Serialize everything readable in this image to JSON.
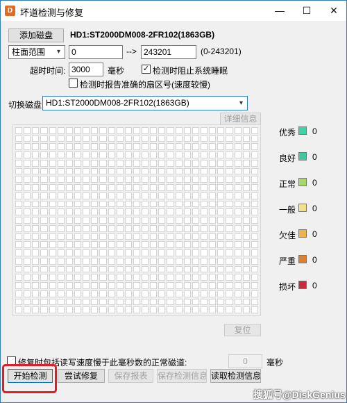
{
  "window": {
    "title": "坏道检测与修复",
    "icon_label": "D",
    "controls": {
      "minimize": "—",
      "maximize": "☐",
      "close": "✕"
    }
  },
  "toolbar": {
    "add_disk_label": "添加磁盘",
    "disk_name": "HD1:ST2000DM008-2FR102(1863GB)"
  },
  "range": {
    "mode_options_selected": "柱面范围",
    "from_value": "0",
    "arrow": "-->",
    "to_value": "243201",
    "hint": "(0-243201)"
  },
  "timeout": {
    "label": "超时时间:",
    "value": "3000",
    "unit": "毫秒",
    "prevent_sleep_label": "检测时阻止系统睡眠",
    "prevent_sleep_checked": "✓",
    "report_sectors_label": "检测时报告准确的扇区号(速度较慢)",
    "report_sectors_checked": ""
  },
  "switch_disk": {
    "label": "切换磁盘:",
    "selected": "HD1:ST2000DM008-2FR102(1863GB)"
  },
  "detail_button_label": "详细信息",
  "reset_button_label": "复位",
  "legend": [
    {
      "label": "优秀",
      "count": "0",
      "color": "#3fd4a8"
    },
    {
      "label": "良好",
      "count": "0",
      "color": "#3ec9a0"
    },
    {
      "label": "正常",
      "count": "0",
      "color": "#a8d86a"
    },
    {
      "label": "一般",
      "count": "0",
      "color": "#f5e08a"
    },
    {
      "label": "欠佳",
      "count": "0",
      "color": "#f0b04a"
    },
    {
      "label": "严重",
      "count": "0",
      "color": "#e0802a"
    },
    {
      "label": "损坏",
      "count": "0",
      "color": "#c82a3a"
    }
  ],
  "repair_option": {
    "label": "修复时包括读写速度慢于此毫秒数的正常磁道:",
    "value": "0",
    "unit": "毫秒",
    "checked": ""
  },
  "actions": {
    "start": "开始检测",
    "try_repair": "尝试修复",
    "save_report": "保存报表",
    "save_info": "保存检测信息",
    "read_info": "读取检测信息"
  },
  "watermark": "搜狐号@DiskGenius",
  "colors": {
    "accent": "#2b7bd1",
    "highlight": "#e21c24"
  }
}
